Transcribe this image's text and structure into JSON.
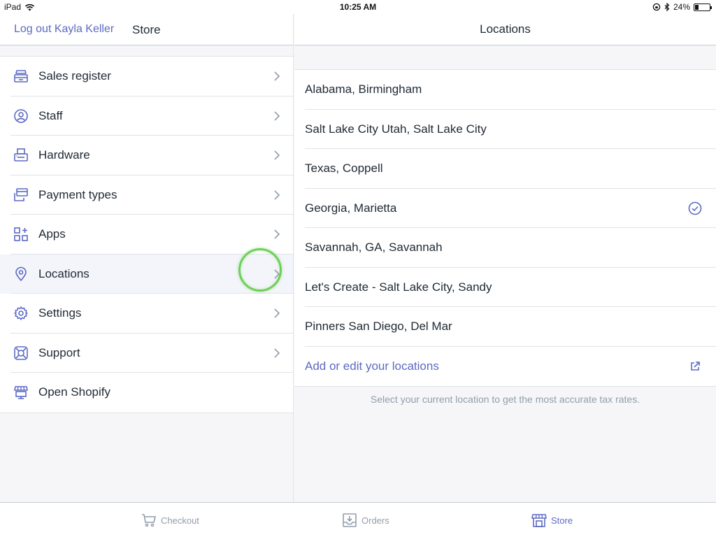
{
  "status_bar": {
    "device": "iPad",
    "time": "10:25 AM",
    "battery": "24%",
    "battery_level": 0.24
  },
  "left_header": {
    "logout_label": "Log out Kayla Keller",
    "title": "Store"
  },
  "right_header": {
    "title": "Locations"
  },
  "menu": {
    "items": [
      {
        "label": "Sales register",
        "icon": "register-icon"
      },
      {
        "label": "Staff",
        "icon": "user-icon"
      },
      {
        "label": "Hardware",
        "icon": "printer-icon"
      },
      {
        "label": "Payment types",
        "icon": "cards-icon"
      },
      {
        "label": "Apps",
        "icon": "apps-icon"
      },
      {
        "label": "Locations",
        "icon": "location-pin-icon",
        "selected": true
      },
      {
        "label": "Settings",
        "icon": "gear-icon"
      },
      {
        "label": "Support",
        "icon": "lifebuoy-icon"
      },
      {
        "label": "Open Shopify",
        "icon": "storefront-icon"
      }
    ]
  },
  "locations": {
    "items": [
      {
        "label": "Alabama, Birmingham"
      },
      {
        "label": "Salt Lake City Utah, Salt Lake City"
      },
      {
        "label": "Texas, Coppell"
      },
      {
        "label": "Georgia, Marietta",
        "checked": true
      },
      {
        "label": "Savannah, GA, Savannah"
      },
      {
        "label": "Let's Create - Salt Lake City, Sandy"
      },
      {
        "label": "Pinners San Diego, Del Mar"
      }
    ],
    "edit_link": "Add or edit your locations",
    "footnote": "Select your current location to get the most accurate tax rates."
  },
  "tabs": [
    {
      "label": "Checkout",
      "icon": "cart-icon"
    },
    {
      "label": "Orders",
      "icon": "inbox-icon"
    },
    {
      "label": "Store",
      "icon": "store-icon",
      "active": true
    }
  ],
  "colors": {
    "accent": "#5c6ac4",
    "touch_indicator": "#6fcf5a",
    "muted": "#919eab"
  }
}
